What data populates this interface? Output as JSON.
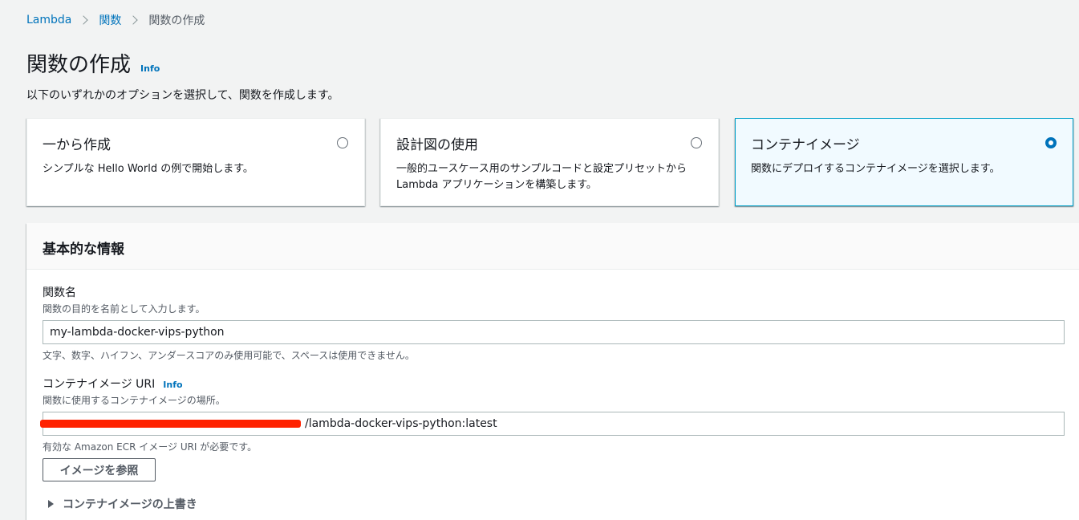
{
  "breadcrumb": {
    "items": [
      "Lambda",
      "関数"
    ],
    "current": "関数の作成"
  },
  "header": {
    "title": "関数の作成",
    "info": "Info",
    "subtitle": "以下のいずれかのオプションを選択して、関数を作成します。"
  },
  "options": [
    {
      "title": "一から作成",
      "description": "シンプルな Hello World の例で開始します。",
      "selected": false
    },
    {
      "title": "設計図の使用",
      "description": "一般的ユースケース用のサンプルコードと設定プリセットから Lambda アプリケーションを構築します。",
      "selected": false
    },
    {
      "title": "コンテナイメージ",
      "description": "関数にデプロイするコンテナイメージを選択します。",
      "selected": true
    }
  ],
  "basic_info": {
    "title": "基本的な情報",
    "function_name": {
      "label": "関数名",
      "description": "関数の目的を名前として入力します。",
      "value": "my-lambda-docker-vips-python",
      "constraint": "文字、数字、ハイフン、アンダースコアのみ使用可能で、スペースは使用できません。"
    },
    "image_uri": {
      "label": "コンテナイメージ URI",
      "info": "Info",
      "description": "関数に使用するコンテナイメージの場所。",
      "value": "/lambda-docker-vips-python:latest",
      "constraint": "有効な Amazon ECR イメージ URI が必要です。",
      "browse_label": "イメージを参照"
    },
    "override_label": "コンテナイメージの上書き"
  },
  "colors": {
    "link": "#0073bb",
    "selected_border": "#00a1c9",
    "selected_bg": "#f1faff",
    "redaction": "#ff2200"
  }
}
